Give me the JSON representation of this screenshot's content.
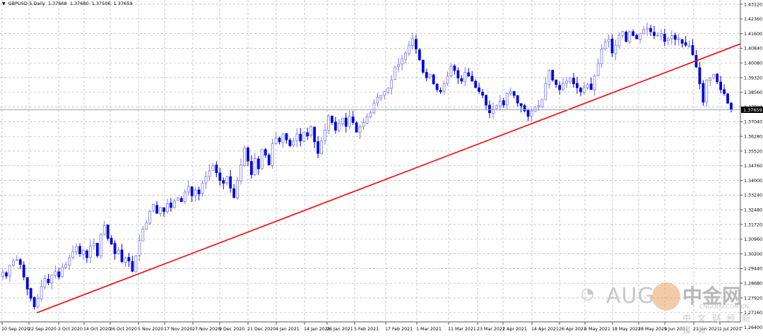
{
  "header": {
    "symbol": "GBPUSD-5,Daily",
    "open": "1.37668",
    "high": "1.37680",
    "low": "1.37506",
    "close": "1.37659"
  },
  "colors": {
    "bull": "#7b7bf0",
    "bear": "#0000e0",
    "trendline": "#ff0000",
    "grid": "#a9b0bc",
    "price_line": "#9aa4b0",
    "price_label_bg": "#000000"
  },
  "watermark": {
    "left": "AUG",
    "brand": "中金网",
    "site": "CNGOLD.COM.CN",
    "slogan": "中文财经新媒体"
  },
  "chart_data": {
    "type": "candlestick",
    "title": "GBPUSD-5,Daily",
    "ylim": [
      1.264,
      1.4312
    ],
    "grid": true,
    "y_ticks": [
      "1.43120",
      "1.42360",
      "1.41600",
      "1.40840",
      "1.40080",
      "1.39320",
      "1.38560",
      "1.37800",
      "1.37040",
      "1.36280",
      "1.35520",
      "1.34760",
      "1.34000",
      "1.33240",
      "1.32480",
      "1.31720",
      "1.30960",
      "1.30200",
      "1.29440",
      "1.28680",
      "1.27920",
      "1.27160",
      "1.26400"
    ],
    "x_ticks": [
      "10 Sep 2020",
      "22 Sep 2020",
      "2 Oct 2020",
      "14 Oct 2020",
      "26 Oct 2020",
      "5 Nov 2020",
      "17 Nov 2020",
      "27 Nov 2020",
      "9 Dec 2020",
      "21 Dec 2020",
      "4 Jan 2021",
      "14 Jan 2021",
      "26 Jan 2021",
      "5 Feb 2021",
      "17 Feb 2021",
      "1 Mar 2021",
      "11 Mar 2021",
      "23 Mar 2021",
      "2 Apr 2021",
      "14 Apr 2021",
      "26 Apr 2021",
      "6 May 2021",
      "18 May 2021",
      "28 May 2021",
      "9 Jun 2021",
      "21 Jun 2021",
      "1 Jul 2021"
    ],
    "current_price": "1.37659",
    "trendline": {
      "from": {
        "date": "23 Sep 2020",
        "price": 1.2715
      },
      "to": {
        "price": 1.4107
      }
    },
    "closes": [
      1.2925,
      1.2905,
      1.296,
      1.2983,
      1.299,
      1.2965,
      1.29,
      1.2837,
      1.279,
      1.2746,
      1.279,
      1.285,
      1.2892,
      1.287,
      1.291,
      1.2929,
      1.29,
      1.295,
      1.2965,
      1.3,
      1.303,
      1.3056,
      1.302,
      1.3038,
      1.3,
      1.306,
      1.3075,
      1.301,
      1.312,
      1.3166,
      1.31,
      1.307,
      1.302,
      1.3038,
      1.298,
      1.3,
      1.2983,
      1.293,
      1.301,
      1.309,
      1.3148,
      1.318,
      1.324,
      1.3275,
      1.323,
      1.326,
      1.3239,
      1.328,
      1.326,
      1.3294,
      1.331,
      1.329,
      1.334,
      1.3367,
      1.332,
      1.335,
      1.333,
      1.3385,
      1.342,
      1.345,
      1.3476,
      1.344,
      1.34,
      1.3385,
      1.342,
      1.336,
      1.3312,
      1.34,
      1.348,
      1.3567,
      1.35,
      1.343,
      1.3513,
      1.346,
      1.356,
      1.3531,
      1.348,
      1.359,
      1.362,
      1.36,
      1.364,
      1.361,
      1.358,
      1.3604,
      1.364,
      1.3604,
      1.365,
      1.363,
      1.3677,
      1.36,
      1.354,
      1.3604,
      1.366,
      1.3732,
      1.37,
      1.366,
      1.3695,
      1.372,
      1.368,
      1.3732,
      1.37,
      1.365,
      1.3677,
      1.37,
      1.373,
      1.375,
      1.38,
      1.383,
      1.3841,
      1.386,
      1.3878,
      1.392,
      1.3987,
      1.4,
      1.403,
      1.406,
      1.41,
      1.4133,
      1.408,
      1.4024,
      1.396,
      1.3932,
      1.395,
      1.39,
      1.387,
      1.3859,
      1.39,
      1.394,
      1.399,
      1.3969,
      1.393,
      1.3914,
      1.396,
      1.394,
      1.3914,
      1.388,
      1.386,
      1.3841,
      1.379,
      1.375,
      1.377,
      1.3786,
      1.381,
      1.379,
      1.385,
      1.3859,
      1.384,
      1.38,
      1.3786,
      1.376,
      1.3732,
      1.376,
      1.378,
      1.3786,
      1.382,
      1.39,
      1.3969,
      1.392,
      1.3896,
      1.387,
      1.39,
      1.3914,
      1.393,
      1.39,
      1.388,
      1.3859,
      1.388,
      1.3896,
      1.387,
      1.394,
      1.4005,
      1.408,
      1.4115,
      1.413,
      1.406,
      1.41,
      1.4151,
      1.417,
      1.412,
      1.417,
      1.415,
      1.4133,
      1.416,
      1.418,
      1.4188,
      1.417,
      1.415,
      1.4151,
      1.416,
      1.412,
      1.4133,
      1.415,
      1.413,
      1.4133,
      1.411,
      1.41,
      1.4097,
      1.405,
      1.3987,
      1.39,
      1.3805,
      1.392,
      1.393,
      1.395,
      1.391,
      1.387,
      1.385,
      1.38,
      1.37659
    ]
  }
}
